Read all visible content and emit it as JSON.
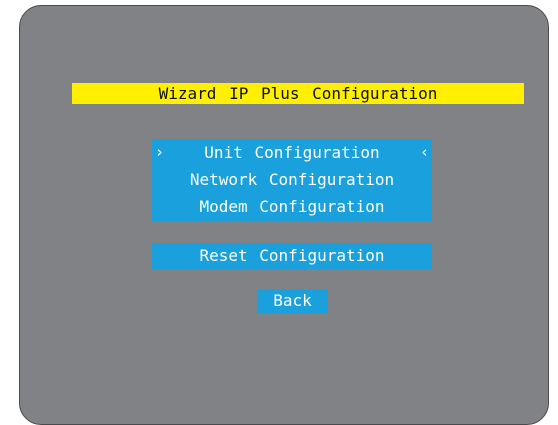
{
  "title": "Wizard IP Plus Configuration",
  "menu": {
    "items": [
      {
        "label": "Unit Configuration",
        "selected": true
      },
      {
        "label": "Network Configuration",
        "selected": false
      },
      {
        "label": "Modem Configuration",
        "selected": false
      }
    ],
    "selector_left": "›",
    "selector_right": "‹"
  },
  "buttons": {
    "reset": "Reset Configuration",
    "back": "Back"
  },
  "colors": {
    "background": "#808285",
    "title_bg": "#ffef00",
    "menu_bg": "#1aa0dd",
    "text_light": "#ffffff",
    "text_dark": "#111111"
  }
}
